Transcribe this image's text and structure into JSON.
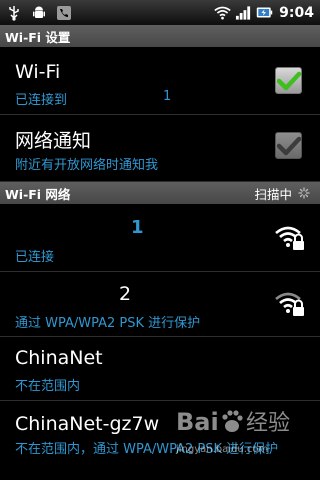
{
  "status_bar": {
    "left_icons": [
      "usb-icon",
      "android-debug-icon",
      "phone-icon"
    ],
    "right_icons": [
      "wifi-icon",
      "signal-icon",
      "battery-charging-icon"
    ],
    "time": "9:04"
  },
  "wifi_settings": {
    "header": "Wi-Fi 设置",
    "wifi_toggle": {
      "title": "Wi-Fi",
      "subtitle": "已连接到",
      "network_name": "1",
      "checked": true
    },
    "network_notify": {
      "title": "网络通知",
      "subtitle": "附近有开放网络时通知我",
      "checked": true,
      "enabled": false
    }
  },
  "networks": {
    "header": "Wi-Fi 网络",
    "scan_label": "扫描中",
    "items": [
      {
        "ssid": "1",
        "status": "已连接",
        "secured": true,
        "highlight": true
      },
      {
        "ssid": "2",
        "status": "通过 WPA/WPA2 PSK 进行保护",
        "secured": true,
        "highlight": false
      },
      {
        "ssid": "ChinaNet",
        "status": "不在范围内",
        "secured": false,
        "highlight": false
      },
      {
        "ssid": "ChinaNet-gz7w",
        "status": "不在范围内，通过 WPA/WPA2 PSK 进行保护",
        "secured": false,
        "highlight": false
      }
    ]
  },
  "watermark": {
    "brand": "Bai经验",
    "url": "jingyan.baidu.com"
  },
  "colors": {
    "accent": "#2f98d2",
    "check_green": "#3fbf1f",
    "header_bg": "#555555"
  }
}
